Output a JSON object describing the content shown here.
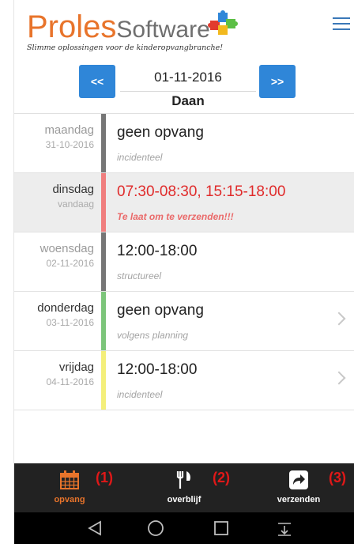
{
  "header": {
    "logo_primary": "Proles",
    "logo_secondary": "Software",
    "tagline": "Slimme oplossingen voor de kinderopvangbranche!"
  },
  "datenav": {
    "prev_label": "<<",
    "next_label": ">>",
    "date": "01-11-2016",
    "name": "Daan"
  },
  "days": [
    {
      "day": "maandag",
      "date": "31-10-2016",
      "main": "geen opvang",
      "sub": "incidenteel",
      "bar_color": "#767676"
    },
    {
      "day": "dinsdag",
      "date": "vandaag",
      "main": "07:30-08:30, 15:15-18:00",
      "sub": "Te laat om te verzenden!!!",
      "bar_color": "#f07e7e"
    },
    {
      "day": "woensdag",
      "date": "02-11-2016",
      "main": "12:00-18:00",
      "sub": "structureel",
      "bar_color": "#767676"
    },
    {
      "day": "donderdag",
      "date": "03-11-2016",
      "main": "geen opvang",
      "sub": "volgens planning",
      "bar_color": "#7cc57a"
    },
    {
      "day": "vrijdag",
      "date": "04-11-2016",
      "main": "12:00-18:00",
      "sub": "incidenteel",
      "bar_color": "#f4ef7a"
    }
  ],
  "tabs": [
    {
      "label": "opvang",
      "number": "(1)",
      "icon": "calendar-icon"
    },
    {
      "label": "overblijf",
      "number": "(2)",
      "icon": "fork-knife-icon"
    },
    {
      "label": "verzenden",
      "number": "(3)",
      "icon": "share-icon"
    }
  ],
  "colors": {
    "accent_orange": "#e8742b",
    "nav_blue": "#2f86d8",
    "alert_red": "#e02b2b",
    "tabbar_bg": "#222222"
  }
}
